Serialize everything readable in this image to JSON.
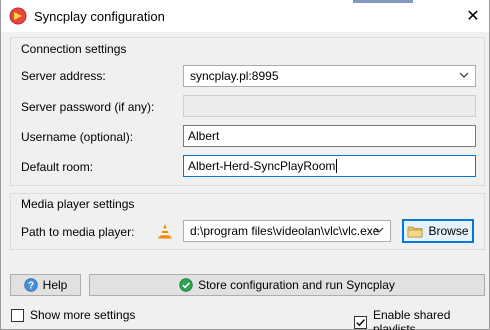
{
  "window": {
    "title": "Syncplay configuration",
    "close_label": "✕"
  },
  "connection": {
    "group_title": "Connection settings",
    "server_address_label": "Server address:",
    "server_address_value": "syncplay.pl:8995",
    "server_password_label": "Server password (if any):",
    "server_password_value": "",
    "username_label": "Username (optional):",
    "username_value": "Albert",
    "default_room_label": "Default room:",
    "default_room_value": "Albert-Herd-SyncPlayRoom"
  },
  "media": {
    "group_title": "Media player settings",
    "path_label": "Path to media player:",
    "path_value": "d:\\program files\\videolan\\vlc\\vlc.exe",
    "browse_label": "Browse",
    "player_icon": "vlc-cone-icon"
  },
  "actions": {
    "help_label": "Help",
    "store_label": "Store configuration and run Syncplay"
  },
  "options": {
    "show_more_label": "Show more settings",
    "show_more_checked": false,
    "shared_playlists_label": "Enable shared playlists",
    "shared_playlists_checked": true
  },
  "colors": {
    "accent": "#0078d7",
    "vlc_orange": "#f08a00",
    "app_icon_red": "#e8453c",
    "check_green": "#2ea44f"
  }
}
